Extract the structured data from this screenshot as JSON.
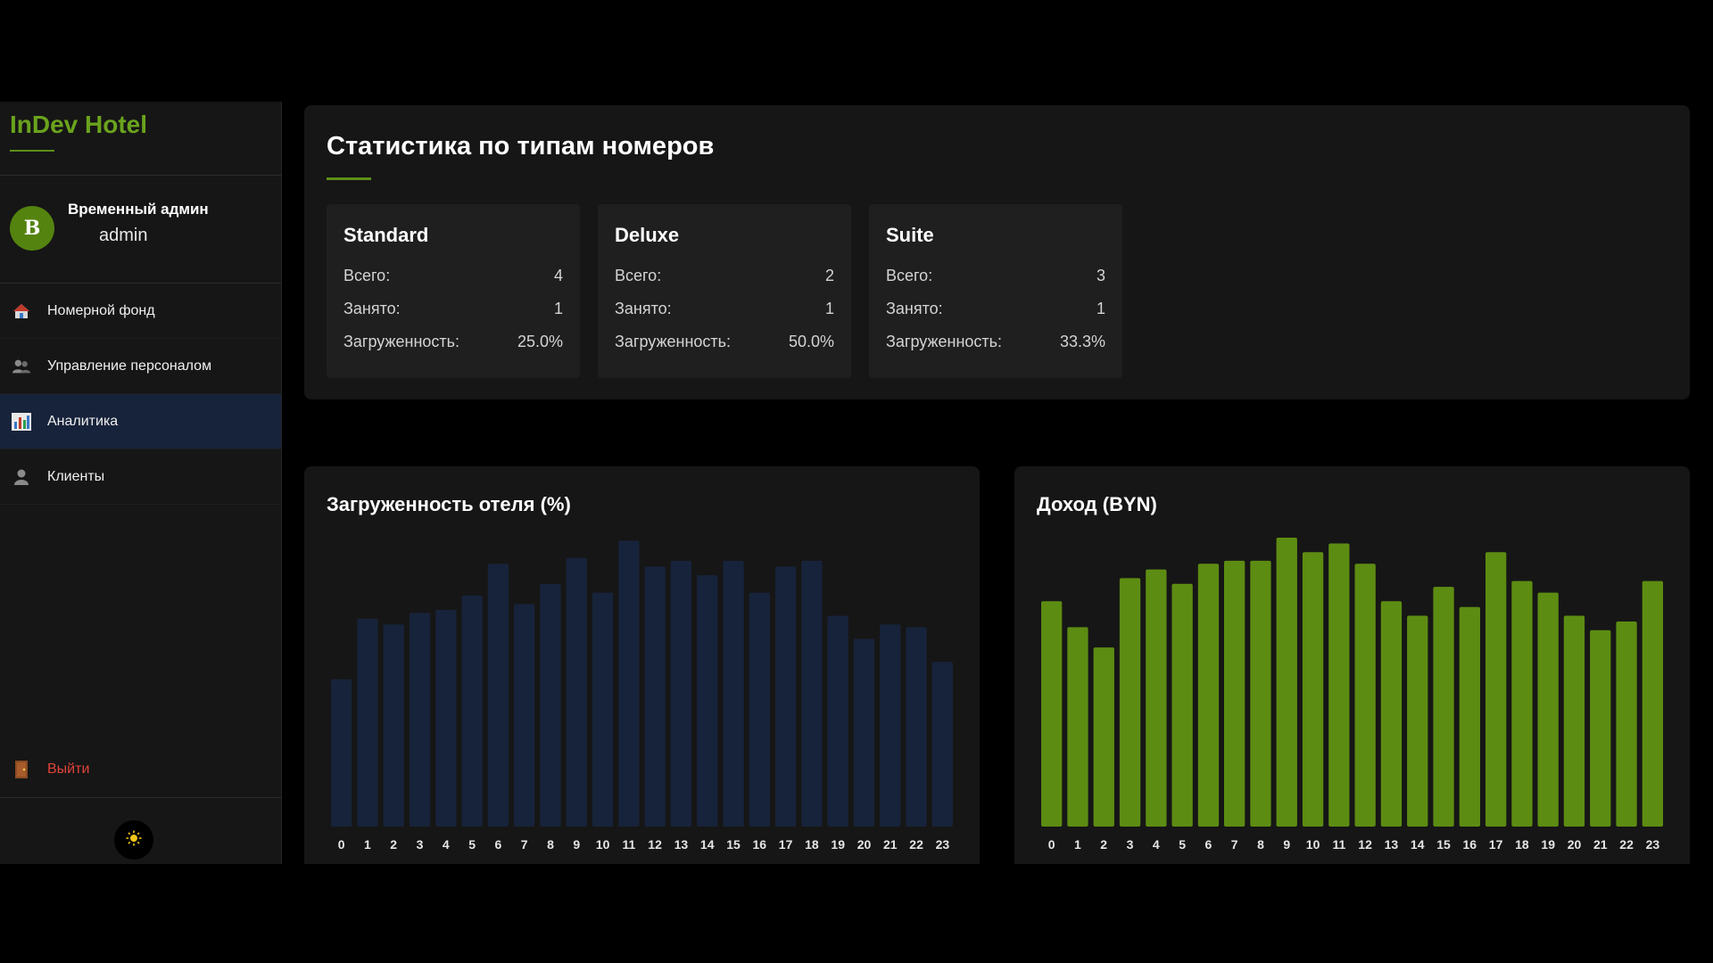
{
  "sidebar": {
    "brand": "InDev Hotel",
    "user": {
      "avatar_letter": "В",
      "name": "Временный админ",
      "login": "admin"
    },
    "nav": [
      {
        "label": "Номерной фонд",
        "icon": "house-icon",
        "active": false
      },
      {
        "label": "Управление персоналом",
        "icon": "people-icon",
        "active": false
      },
      {
        "label": "Аналитика",
        "icon": "bar-chart-icon",
        "active": true
      },
      {
        "label": "Клиенты",
        "icon": "person-icon",
        "active": false
      }
    ],
    "logout_label": "Выйти",
    "theme_icon": "sun-icon"
  },
  "stats": {
    "title": "Статистика по типам номеров",
    "total_label": "Всего:",
    "occupied_label": "Занято:",
    "load_label": "Загруженность:",
    "rooms": [
      {
        "name": "Standard",
        "total": "4",
        "occupied": "1",
        "load": "25.0%"
      },
      {
        "name": "Deluxe",
        "total": "2",
        "occupied": "1",
        "load": "50.0%"
      },
      {
        "name": "Suite",
        "total": "3",
        "occupied": "1",
        "load": "33.3%"
      }
    ]
  },
  "colors": {
    "accent_green": "#5c8f19",
    "occupancy_bar": "#17233a",
    "income_bar": "#5d8c12",
    "logout_red": "#e0433a",
    "active_nav": "#17233a"
  },
  "chart_data": [
    {
      "type": "bar",
      "title": "Загруженность отеля (%)",
      "categories": [
        "0",
        "1",
        "2",
        "3",
        "4",
        "5",
        "6",
        "7",
        "8",
        "9",
        "10",
        "11",
        "12",
        "13",
        "14",
        "15",
        "16",
        "17",
        "18",
        "19",
        "20",
        "21",
        "22",
        "23"
      ],
      "values": [
        51,
        72,
        70,
        74,
        75,
        80,
        91,
        77,
        84,
        93,
        81,
        99,
        90,
        92,
        87,
        92,
        81,
        90,
        92,
        73,
        65,
        70,
        69,
        57
      ],
      "ylim": [
        0,
        100
      ],
      "grid": false,
      "legend": "none"
    },
    {
      "type": "bar",
      "title": "Доход (BYN)",
      "categories": [
        "0",
        "1",
        "2",
        "3",
        "4",
        "5",
        "6",
        "7",
        "8",
        "9",
        "10",
        "11",
        "12",
        "13",
        "14",
        "15",
        "16",
        "17",
        "18",
        "19",
        "20",
        "21",
        "22",
        "23"
      ],
      "values": [
        78,
        69,
        62,
        86,
        89,
        84,
        91,
        92,
        92,
        100,
        95,
        98,
        91,
        78,
        73,
        83,
        76,
        95,
        85,
        81,
        73,
        68,
        71,
        85
      ],
      "ylim": [
        0,
        100
      ],
      "grid": false,
      "legend": "none"
    }
  ]
}
